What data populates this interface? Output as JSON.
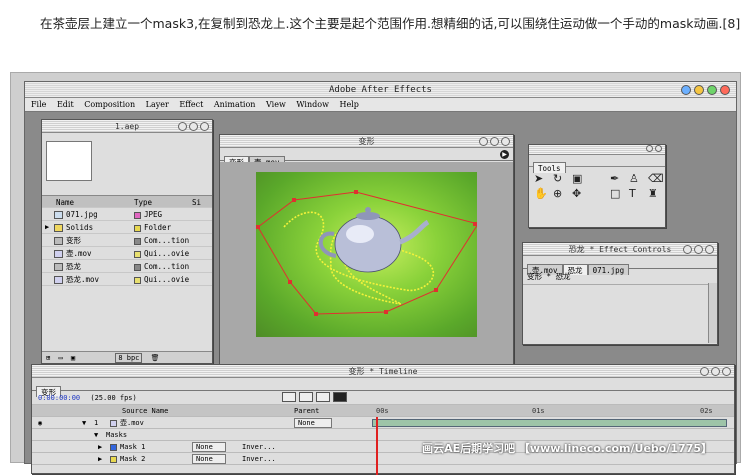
{
  "caption": "在茶壶层上建立一个mask3,在复制到恐龙上.这个主要是起个范围作用.想精细的话,可以围绕住运动做一个手动的mask动画.[8]",
  "app": {
    "title": "Adobe After Effects",
    "menu": [
      "File",
      "Edit",
      "Composition",
      "Layer",
      "Effect",
      "Animation",
      "View",
      "Window",
      "Help"
    ]
  },
  "project": {
    "title": "1.aep",
    "headers": {
      "name": "Name",
      "type": "Type",
      "size": "Si"
    },
    "items": [
      {
        "name": "071.jpg",
        "type": "JPEG",
        "color": "#e066c0"
      },
      {
        "name": "Solids",
        "type": "Folder",
        "color": "#e8d850"
      },
      {
        "name": "变形",
        "type": "Com...tion",
        "color": "#888888"
      },
      {
        "name": "壶.mov",
        "type": "Qui...ovie",
        "color": "#e8e070"
      },
      {
        "name": "恐龙",
        "type": "Com...tion",
        "color": "#888888"
      },
      {
        "name": "恐龙.mov",
        "type": "Qui...ovie",
        "color": "#e8e070"
      }
    ],
    "footer_bpc": "8 bpc"
  },
  "comp": {
    "title": "变形",
    "tabs": [
      "变形",
      "壶.mov"
    ]
  },
  "tools": {
    "title": "Tools"
  },
  "effects": {
    "title": "恐龙 * Effect Controls",
    "tabs": [
      "壶.mov",
      "恐龙",
      "071.jpg"
    ],
    "path": "变形 * 恐龙"
  },
  "timeline": {
    "title": "变形 * Timeline",
    "tab": "变形",
    "timecode": "0:00:00:00",
    "fps": "(25.00 fps)",
    "col_source": "Source Name",
    "col_parent": "Parent",
    "ruler": [
      "00s",
      "01s",
      "02s"
    ],
    "rows": [
      {
        "num": "1",
        "name": "壶.mov",
        "parent": "None"
      },
      {
        "num": "",
        "name": "Masks",
        "parent": ""
      },
      {
        "num": "",
        "name": "Mask 1",
        "mode": "None",
        "inv": "Inver..."
      },
      {
        "num": "",
        "name": "Mask 2",
        "mode": "None",
        "inv": "Inver..."
      }
    ]
  },
  "watermark": "画云AE后期学习吧 【www.lineco.com/Uebo/1775】"
}
